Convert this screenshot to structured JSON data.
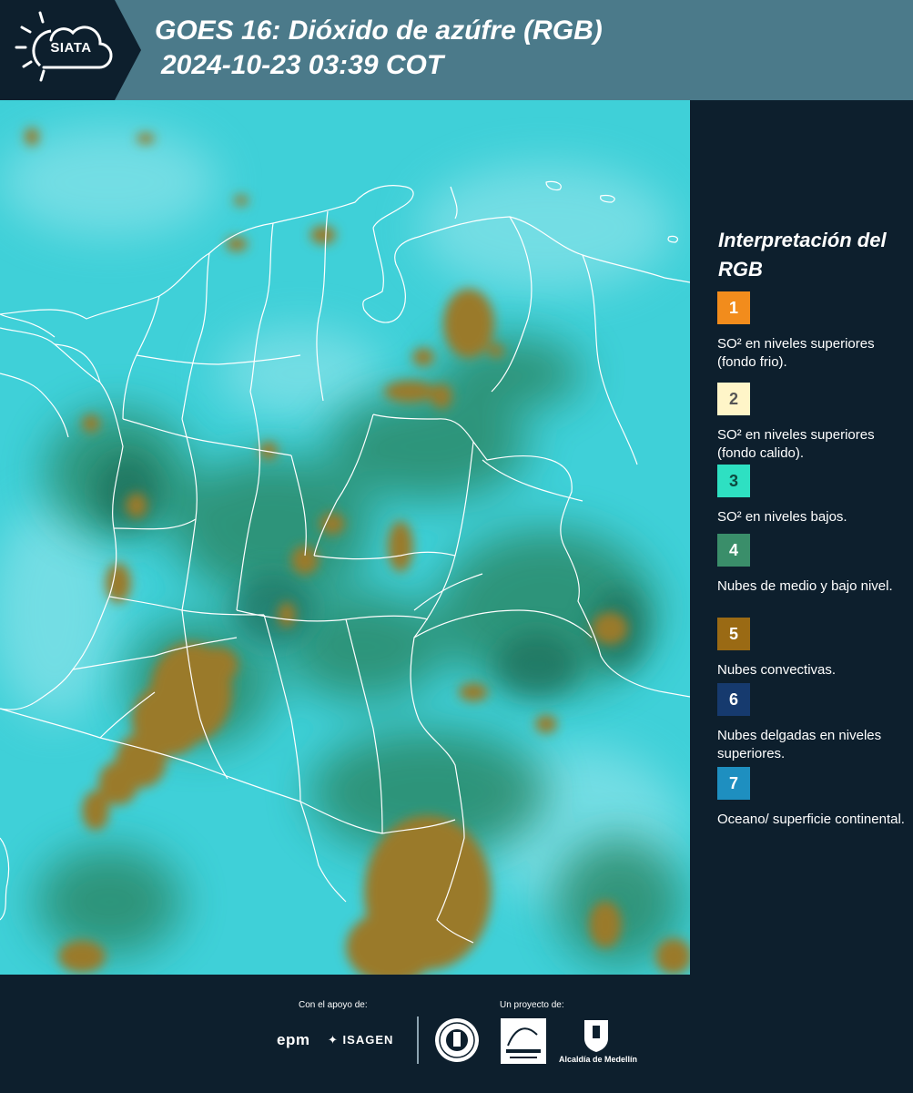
{
  "header": {
    "logo_text": "SIATA",
    "title": "GOES 16: Dióxido de azúfre (RGB)",
    "subtitle": "2024-10-23 03:39 COT",
    "background_color": "#4b7a8a"
  },
  "legend": {
    "title": "Interpretación del RGB",
    "items": [
      {
        "number": "1",
        "label": "SO² en niveles superiores (fondo frio).",
        "color": "#f28c1c",
        "text_color": "#ffffff"
      },
      {
        "number": "2",
        "label": "SO² en niveles superiores (fondo calido).",
        "color": "#fff5c8",
        "text_color": "#555555"
      },
      {
        "number": "3",
        "label": "SO² en niveles bajos.",
        "color": "#2ee0c2",
        "text_color": "#0d4a40"
      },
      {
        "number": "4",
        "label": "Nubes de medio y bajo nivel.",
        "color": "#3a8e6a",
        "text_color": "#ffffff"
      },
      {
        "number": "5",
        "label": "Nubes convectivas.",
        "color": "#9a6a14",
        "text_color": "#ffffff"
      },
      {
        "number": "6",
        "label": "Nubes delgadas en niveles superiores.",
        "color": "#163a6e",
        "text_color": "#ffffff"
      },
      {
        "number": "7",
        "label": "Oceano/ superficie continental.",
        "color": "#1e8fc0",
        "text_color": "#ffffff"
      }
    ]
  },
  "footer": {
    "support_label": "Con el apoyo de:",
    "project_label": "Un proyecto de:",
    "sponsor_1": "epm",
    "sponsor_2": "ISAGEN",
    "partner_3": "Alcaldía de Medellín"
  },
  "map": {
    "background_color": "#3fd0d8",
    "cloud_color": "#9a7a2a",
    "low_cloud_color": "#2a8a6a",
    "boundary_color": "#ffffff"
  }
}
